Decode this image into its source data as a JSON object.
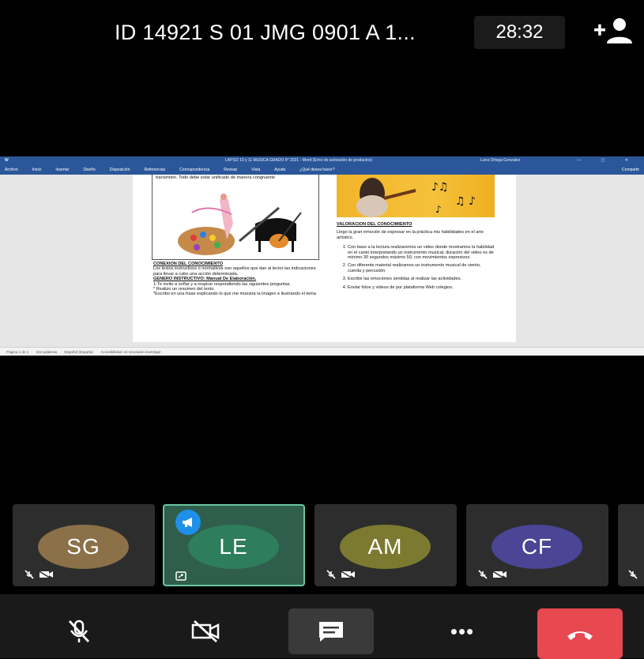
{
  "top": {
    "meeting_title": "ID 14921 S 01 JMG 0901 A 1...",
    "timer": "28:32"
  },
  "shared_doc": {
    "window_title": "LAPSO 10 y 11 MUSICA GRADO 9° 2021 - Word (Error de activación de productos)",
    "user_name": "Luna Ortega Gonzalez",
    "ribbon_tabs": [
      "Archivo",
      "Inicio",
      "Insertar",
      "Diseño",
      "Disposición",
      "Referencias",
      "Correspondencia",
      "Revisar",
      "Vista",
      "Ayuda",
      "¿Qué desea hacer?"
    ],
    "share_label": "Compartir",
    "left_top_text": "transmiten. Todo debe estar unificado de manera congruente",
    "left_heading": "CONEXION DEL CONOCIMIENTO",
    "left_body": "Los textos instructivos o normativos son aquellos que dan al lector las indicaciones para llevar a cabo una acción determinada.",
    "left_subheading": "GENERO INSTRUCTIVO: Manual De Elaboración.",
    "left_items": [
      "1-Te invito a soñar y a respirar respondiendo las siguientes preguntas.",
      "* Realizo un resumen del texto.",
      "*Escribo en una frase explicando lo que me muestra la imagen e ilustrando el tema"
    ],
    "right_heading": "VALORACION DEL CONOCIMIENTO",
    "right_intro": "Llego la gran emoción de expresar en la práctica mis habilidades en el arte artístico.",
    "right_items": [
      "Con base a la lectura realizaremos un video donde mostramos la habilidad en el canto interpretando un instrumento musical, duración del video es de mínimo 30 segundos máximo 50, con movimientos expresivos.",
      "Con diferente material realizamos un instrumento musical de viento, cuerda y percusión.",
      "Escribe las emociones sentidas al realizar las actividades.",
      "Enviar fotos y videos de por plataforma Web colegios."
    ],
    "status_page": "Página 1 de 1",
    "status_words": "444 palabras",
    "status_lang": "Español (España)",
    "status_access": "Accesibilidad: es necesario investigar"
  },
  "participants": [
    {
      "initials": "SG",
      "color": "#8b7048"
    },
    {
      "initials": "LE",
      "color": "#2e7d5b"
    },
    {
      "initials": "AM",
      "color": "#7c7a30"
    },
    {
      "initials": "CF",
      "color": "#4a4595"
    }
  ],
  "toolbar": {
    "more_label": "•••"
  },
  "colors": {
    "accent_blue": "#1e90e8",
    "end_call_red": "#e8484f",
    "active_border": "#6ac4a0"
  }
}
